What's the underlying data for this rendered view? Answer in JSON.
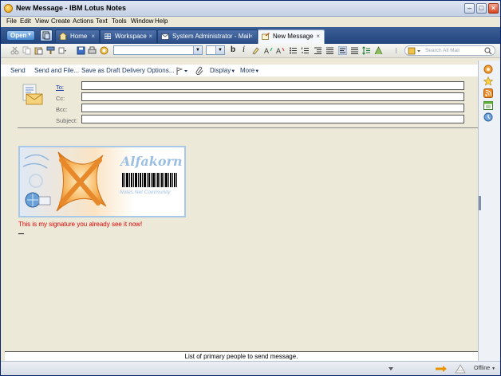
{
  "window": {
    "title": "New Message - IBM Lotus Notes"
  },
  "menu": [
    "File",
    "Edit",
    "View",
    "Create",
    "Actions",
    "Text",
    "Tools",
    "Window",
    "Help"
  ],
  "tabbar": {
    "open_label": "Open",
    "tabs": [
      {
        "label": "Home",
        "icon": "home-icon"
      },
      {
        "label": "Workspace",
        "icon": "workspace-icon"
      },
      {
        "label": "System Administrator - Mail",
        "icon": "mail-icon"
      },
      {
        "label": "New Message",
        "icon": "new-message-icon",
        "active": true
      }
    ]
  },
  "toolbar": {
    "bold": "b",
    "italic": "i",
    "search_placeholder": "Search All Mail"
  },
  "actions": [
    "Send",
    "Send and File...",
    "Save as Draft",
    "Delivery Options...",
    "Display",
    "More"
  ],
  "header": {
    "to_label": "To:",
    "cc_label": "Cc:",
    "bcc_label": "Bcc:",
    "subject_label": "Subject:",
    "to_value": "",
    "cc_value": "",
    "bcc_value": "",
    "subject_value": ""
  },
  "body": {
    "logo_brand": "Alfakorn",
    "logo_tagline": "Notes.Net Community",
    "signature_text": "This is my signature you already see it now!"
  },
  "status": {
    "hint": "List of primary people to send message.",
    "connection": "Offline"
  },
  "colors": {
    "tabbar": "#22457e",
    "signature": "#e00000",
    "logo_text": "#9bbfe3"
  }
}
